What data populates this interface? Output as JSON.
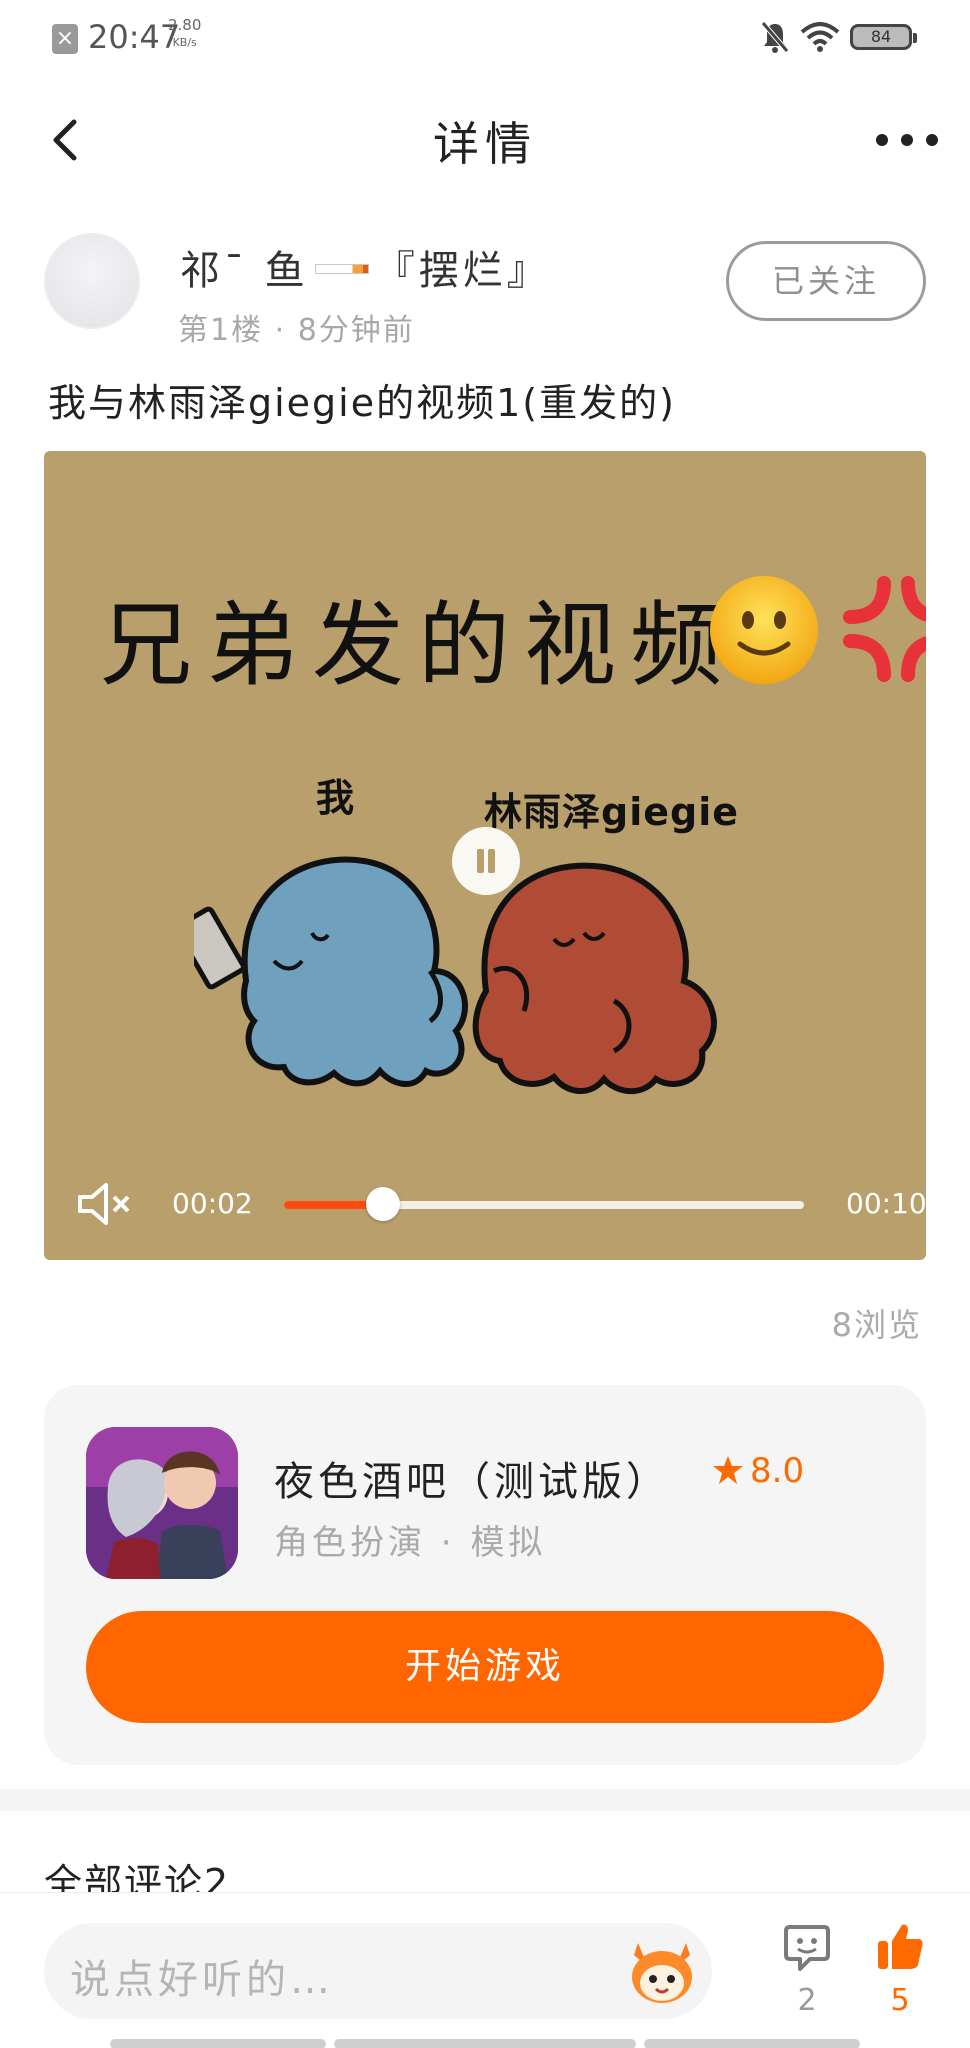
{
  "status_bar": {
    "time": "20:47",
    "speed_value": "2.80",
    "speed_unit": "KB/s",
    "battery": "84"
  },
  "nav": {
    "title": "详情"
  },
  "post": {
    "author_name_part1": "祁ˉ 鱼",
    "author_name_part2": "『摆烂』",
    "floor": "第1楼",
    "time_ago": "8分钟前",
    "follow_label": "已关注",
    "title": "我与林雨泽giegie的视频1(重发的)",
    "views": "8浏览"
  },
  "video": {
    "caption": "兄弟发的视频",
    "label_me": "我",
    "label_other": "林雨泽giegie",
    "current_time": "00:02",
    "total_time": "00:10",
    "progress": 0.19,
    "colors": {
      "background": "#b99f6c",
      "progress": "#ff4a10"
    }
  },
  "game": {
    "name": "夜色酒吧（测试版）",
    "rating": "8.0",
    "genre": "角色扮演",
    "subgenre": "模拟",
    "play_label": "开始游戏",
    "accent_color": "#ff6600"
  },
  "comments": {
    "heading": "全部评论2",
    "input_placeholder": "说点好听的…",
    "comment_count": "2",
    "like_count": "5"
  },
  "icons": [
    "back-arrow-icon",
    "more-dots-icon",
    "bell-off-icon",
    "wifi-icon",
    "battery-icon",
    "mute-icon",
    "pause-icon",
    "star-icon",
    "comment-icon",
    "like-icon",
    "mascot-icon"
  ]
}
